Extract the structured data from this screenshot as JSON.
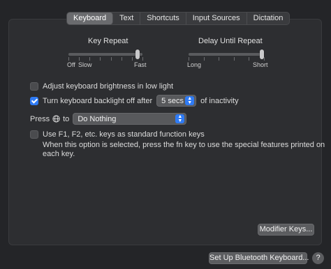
{
  "tabs": [
    {
      "label": "Keyboard",
      "active": true
    },
    {
      "label": "Text",
      "active": false
    },
    {
      "label": "Shortcuts",
      "active": false
    },
    {
      "label": "Input Sources",
      "active": false
    },
    {
      "label": "Dictation",
      "active": false
    }
  ],
  "key_repeat": {
    "title": "Key Repeat",
    "labels": {
      "off": "Off",
      "slow": "Slow",
      "fast": "Fast"
    },
    "value_fraction": 0.93
  },
  "delay_until_repeat": {
    "title": "Delay Until Repeat",
    "labels": {
      "long": "Long",
      "short": "Short"
    },
    "value_fraction": 0.97
  },
  "options": {
    "adjust_brightness": {
      "label": "Adjust keyboard brightness in low light",
      "checked": false
    },
    "backlight_off": {
      "label_before": "Turn keyboard backlight off after",
      "value": "5 secs",
      "label_after": "of inactivity",
      "checked": true
    },
    "press_globe": {
      "label_press": "Press",
      "label_to": "to",
      "value": "Do Nothing"
    },
    "function_keys": {
      "label": "Use F1, F2, etc. keys as standard function keys",
      "checked": false,
      "description_line1": "When this option is selected, press the fn key to use the special features printed on",
      "description_line2": "each key."
    }
  },
  "buttons": {
    "modifier_keys": "Modifier Keys...",
    "bluetooth": "Set Up Bluetooth Keyboard...",
    "help": "?"
  },
  "colors": {
    "accent": "#2f7bf5",
    "background": "#242528",
    "panel": "#2d2e31"
  }
}
